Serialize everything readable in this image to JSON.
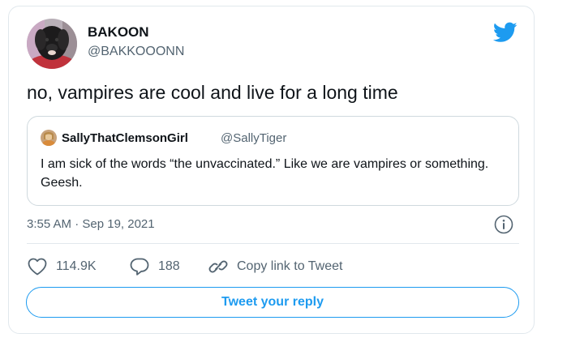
{
  "author": {
    "name": "BAKOON",
    "handle": "@BAKKOOONN",
    "avatar_icon": "dog-avatar"
  },
  "tweet": {
    "text": "no, vampires are cool and live for a long time",
    "timestamp": "3:55 AM · Sep 19, 2021"
  },
  "quoted_tweet": {
    "name": "SallyThatClemsonGirl",
    "handle": "@SallyTiger",
    "text": "I am sick of the words “the unvaccinated.” Like we are vampires or something. Geesh."
  },
  "actions": {
    "likes": "114.9K",
    "replies": "188",
    "copy_link": "Copy link to Tweet"
  },
  "reply_button": "Tweet your reply",
  "colors": {
    "twitter_blue": "#1d9bf0",
    "secondary_text": "#536471",
    "border": "#e1e8ed"
  }
}
